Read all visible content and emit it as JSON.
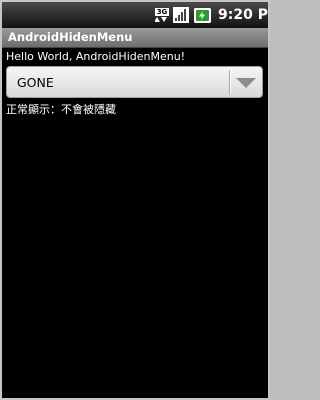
{
  "status_bar": {
    "network_label": "3G",
    "time": "9:20 PM",
    "icons": [
      "3g-data-icon",
      "signal-strength-icon",
      "battery-charging-icon"
    ]
  },
  "app": {
    "title": "AndroidHidenMenu"
  },
  "content": {
    "hello_text": "Hello World, AndroidHidenMenu!",
    "spinner_value": "GONE",
    "status_text": "正常顯示：不會被隱藏"
  },
  "colors": {
    "background": "#000000",
    "title_bar": "#8a8a8a",
    "text": "#ffffff",
    "spinner_bg": "#e8e8e8"
  }
}
